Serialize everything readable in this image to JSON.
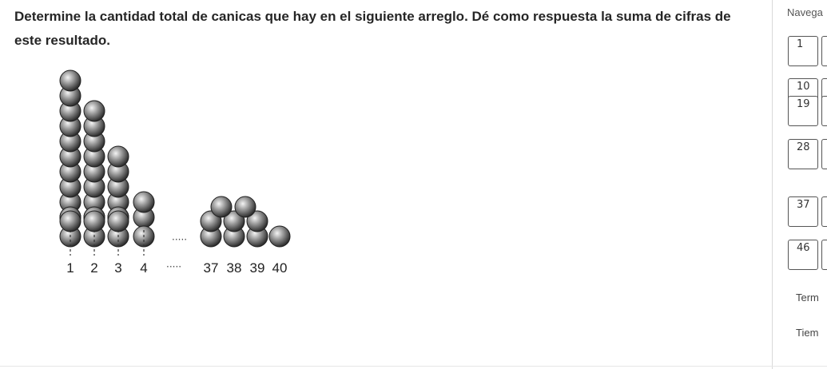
{
  "question": {
    "line1": "Determine la cantidad total de canicas que hay en el siguiente arreglo. Dé como respuesta la suma de cifras de",
    "line2": "este resultado."
  },
  "figure": {
    "column_labels": [
      "1",
      "2",
      "3",
      "4",
      "37",
      "38",
      "39",
      "40"
    ],
    "ellipsis": "·····"
  },
  "sidebar": {
    "title": "Navega",
    "options": [
      "1",
      "10",
      "19",
      "28",
      "37",
      "46"
    ],
    "terminar_label": "Term",
    "tiempo_label": "Tiem"
  }
}
